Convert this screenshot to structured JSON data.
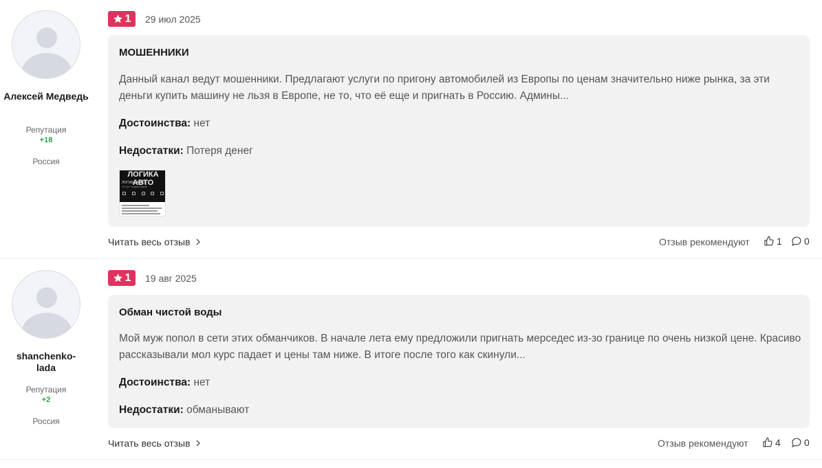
{
  "reviews": [
    {
      "author": {
        "name": "Алексей Медведь",
        "reputation_label": "Репутация",
        "reputation": "+18",
        "country": "Россия"
      },
      "rating": "1",
      "date": "29 июл 2025",
      "title": "МОШЕННИКИ",
      "text": "Данный канал ведут мошенники. Предлагают услуги по пригону автомобилей из Европы по ценам значительно ниже рынка, за эти деньги купить машину не льзя в Европе, не то, что её еще и пригнать в Россию. Админы...",
      "pros_label": "Достоинства:",
      "pros": "нет",
      "cons_label": "Недостатки:",
      "cons": "Потеря денег",
      "thumbnail": {
        "title": "ЛОГИКА АВТО",
        "subtitle": "ЛОГИКА АВТО",
        "subscribers": "15 347 подписчиков"
      },
      "read_more": "Читать весь отзыв",
      "recommend_label": "Отзыв рекомендуют",
      "likes": "1",
      "comments": "0"
    },
    {
      "author": {
        "name": "shanchenko-lada",
        "reputation_label": "Репутация",
        "reputation": "+2",
        "country": "Россия"
      },
      "rating": "1",
      "date": "19 авг 2025",
      "title": "Обман чистой воды",
      "text": "Мой муж попол в сети этих обманчиков. В начале лета ему предложили пригнать мерседес из-зо границе по очень низкой цене. Красиво рассказывали мол курс падает и цены там ниже. В итоге после того как скинули...",
      "pros_label": "Достоинства:",
      "pros": "нет",
      "cons_label": "Недостатки:",
      "cons": "обманывают",
      "read_more": "Читать весь отзыв",
      "recommend_label": "Отзыв рекомендуют",
      "likes": "4",
      "comments": "0"
    }
  ],
  "colors": {
    "badge": "#e0325f",
    "reputation": "#2ea043",
    "card_bg": "#f2f2f2"
  }
}
